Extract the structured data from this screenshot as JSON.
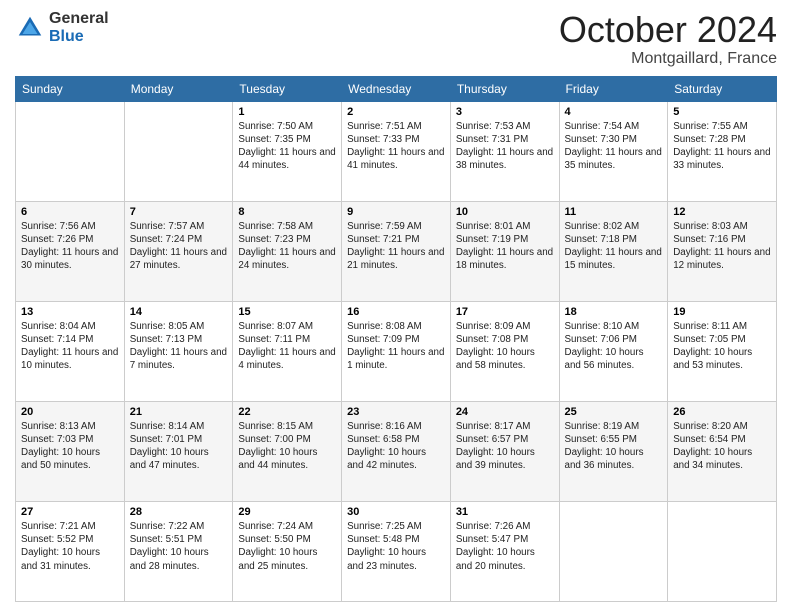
{
  "header": {
    "logo": {
      "general": "General",
      "blue": "Blue"
    },
    "title": "October 2024",
    "location": "Montgaillard, France"
  },
  "days_of_week": [
    "Sunday",
    "Monday",
    "Tuesday",
    "Wednesday",
    "Thursday",
    "Friday",
    "Saturday"
  ],
  "weeks": [
    [
      null,
      null,
      {
        "day": 1,
        "sunrise": "7:50 AM",
        "sunset": "7:35 PM",
        "daylight": "11 hours and 44 minutes."
      },
      {
        "day": 2,
        "sunrise": "7:51 AM",
        "sunset": "7:33 PM",
        "daylight": "11 hours and 41 minutes."
      },
      {
        "day": 3,
        "sunrise": "7:53 AM",
        "sunset": "7:31 PM",
        "daylight": "11 hours and 38 minutes."
      },
      {
        "day": 4,
        "sunrise": "7:54 AM",
        "sunset": "7:30 PM",
        "daylight": "11 hours and 35 minutes."
      },
      {
        "day": 5,
        "sunrise": "7:55 AM",
        "sunset": "7:28 PM",
        "daylight": "11 hours and 33 minutes."
      }
    ],
    [
      {
        "day": 6,
        "sunrise": "7:56 AM",
        "sunset": "7:26 PM",
        "daylight": "11 hours and 30 minutes."
      },
      {
        "day": 7,
        "sunrise": "7:57 AM",
        "sunset": "7:24 PM",
        "daylight": "11 hours and 27 minutes."
      },
      {
        "day": 8,
        "sunrise": "7:58 AM",
        "sunset": "7:23 PM",
        "daylight": "11 hours and 24 minutes."
      },
      {
        "day": 9,
        "sunrise": "7:59 AM",
        "sunset": "7:21 PM",
        "daylight": "11 hours and 21 minutes."
      },
      {
        "day": 10,
        "sunrise": "8:01 AM",
        "sunset": "7:19 PM",
        "daylight": "11 hours and 18 minutes."
      },
      {
        "day": 11,
        "sunrise": "8:02 AM",
        "sunset": "7:18 PM",
        "daylight": "11 hours and 15 minutes."
      },
      {
        "day": 12,
        "sunrise": "8:03 AM",
        "sunset": "7:16 PM",
        "daylight": "11 hours and 12 minutes."
      }
    ],
    [
      {
        "day": 13,
        "sunrise": "8:04 AM",
        "sunset": "7:14 PM",
        "daylight": "11 hours and 10 minutes."
      },
      {
        "day": 14,
        "sunrise": "8:05 AM",
        "sunset": "7:13 PM",
        "daylight": "11 hours and 7 minutes."
      },
      {
        "day": 15,
        "sunrise": "8:07 AM",
        "sunset": "7:11 PM",
        "daylight": "11 hours and 4 minutes."
      },
      {
        "day": 16,
        "sunrise": "8:08 AM",
        "sunset": "7:09 PM",
        "daylight": "11 hours and 1 minute."
      },
      {
        "day": 17,
        "sunrise": "8:09 AM",
        "sunset": "7:08 PM",
        "daylight": "10 hours and 58 minutes."
      },
      {
        "day": 18,
        "sunrise": "8:10 AM",
        "sunset": "7:06 PM",
        "daylight": "10 hours and 56 minutes."
      },
      {
        "day": 19,
        "sunrise": "8:11 AM",
        "sunset": "7:05 PM",
        "daylight": "10 hours and 53 minutes."
      }
    ],
    [
      {
        "day": 20,
        "sunrise": "8:13 AM",
        "sunset": "7:03 PM",
        "daylight": "10 hours and 50 minutes."
      },
      {
        "day": 21,
        "sunrise": "8:14 AM",
        "sunset": "7:01 PM",
        "daylight": "10 hours and 47 minutes."
      },
      {
        "day": 22,
        "sunrise": "8:15 AM",
        "sunset": "7:00 PM",
        "daylight": "10 hours and 44 minutes."
      },
      {
        "day": 23,
        "sunrise": "8:16 AM",
        "sunset": "6:58 PM",
        "daylight": "10 hours and 42 minutes."
      },
      {
        "day": 24,
        "sunrise": "8:17 AM",
        "sunset": "6:57 PM",
        "daylight": "10 hours and 39 minutes."
      },
      {
        "day": 25,
        "sunrise": "8:19 AM",
        "sunset": "6:55 PM",
        "daylight": "10 hours and 36 minutes."
      },
      {
        "day": 26,
        "sunrise": "8:20 AM",
        "sunset": "6:54 PM",
        "daylight": "10 hours and 34 minutes."
      }
    ],
    [
      {
        "day": 27,
        "sunrise": "7:21 AM",
        "sunset": "5:52 PM",
        "daylight": "10 hours and 31 minutes."
      },
      {
        "day": 28,
        "sunrise": "7:22 AM",
        "sunset": "5:51 PM",
        "daylight": "10 hours and 28 minutes."
      },
      {
        "day": 29,
        "sunrise": "7:24 AM",
        "sunset": "5:50 PM",
        "daylight": "10 hours and 25 minutes."
      },
      {
        "day": 30,
        "sunrise": "7:25 AM",
        "sunset": "5:48 PM",
        "daylight": "10 hours and 23 minutes."
      },
      {
        "day": 31,
        "sunrise": "7:26 AM",
        "sunset": "5:47 PM",
        "daylight": "10 hours and 20 minutes."
      },
      null,
      null
    ]
  ]
}
